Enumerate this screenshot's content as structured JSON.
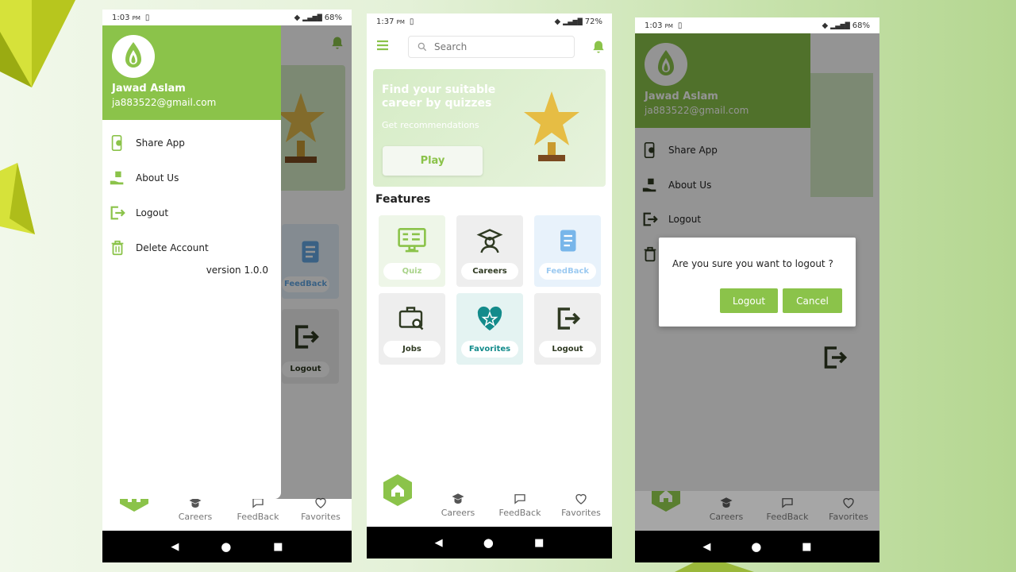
{
  "colors": {
    "accent": "#8bc34a",
    "teal": "#138b8b",
    "dark": "#2f3a22"
  },
  "drawer": {
    "name": "Jawad Aslam",
    "email": "ja883522@gmail.com",
    "menu": [
      {
        "label": "Share App",
        "icon": "share-app-icon"
      },
      {
        "label": "About Us",
        "icon": "about-us-icon"
      },
      {
        "label": "Logout",
        "icon": "logout-icon"
      },
      {
        "label": "Delete Account",
        "icon": "trash-icon"
      }
    ],
    "version": "version 1.0.0"
  },
  "phone1": {
    "time": "1:03",
    "ampm": "PM",
    "battery": "68%",
    "bg_card_label_feedback": "FeedBack",
    "bg_card_label_logout": "Logout"
  },
  "phone2": {
    "time": "1:37",
    "ampm": "PM",
    "battery": "72%",
    "search_placeholder": "Search",
    "banner": {
      "title": "Find your suitable career by quizzes",
      "subtitle": "Get recommendations",
      "button": "Play"
    },
    "features_title": "Features",
    "features": [
      {
        "label": "Quiz",
        "icon": "quiz-icon"
      },
      {
        "label": "Careers",
        "icon": "graduate-icon"
      },
      {
        "label": "FeedBack",
        "icon": "document-icon"
      },
      {
        "label": "Jobs",
        "icon": "briefcase-search-icon"
      },
      {
        "label": "Favorites",
        "icon": "heart-star-icon"
      },
      {
        "label": "Logout",
        "icon": "logout-icon"
      }
    ]
  },
  "phone3": {
    "time": "1:03",
    "ampm": "PM",
    "battery": "68%",
    "dialog": {
      "message": "Are you sure you want to logout  ?",
      "confirm": "Logout",
      "cancel": "Cancel"
    }
  },
  "tabs": {
    "careers": "Careers",
    "feedback": "FeedBack",
    "favorites": "Favorites"
  }
}
